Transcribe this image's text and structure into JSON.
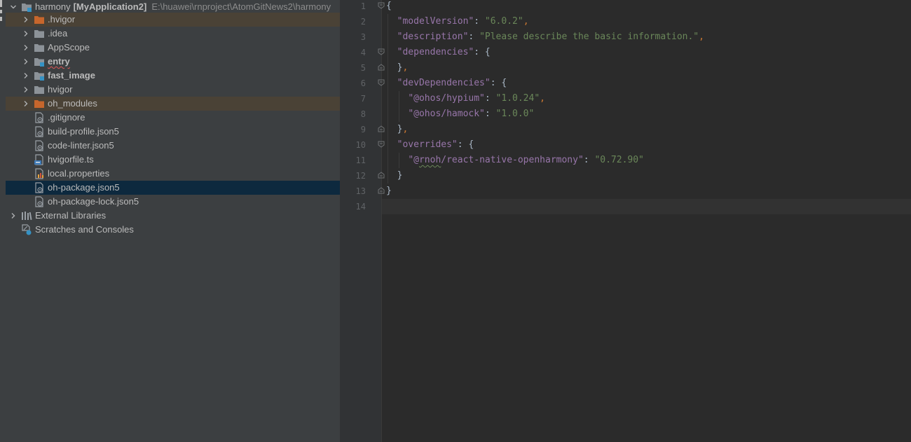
{
  "colors": {
    "panel_bg": "#3c3f41",
    "editor_bg": "#2b2b2b",
    "selection": "#0d293e",
    "excluded_row": "#4a4236",
    "key": "#9876aa",
    "string": "#6a8759",
    "punct_comma": "#cc7832",
    "folder_orange": "#c7662c",
    "folder_gray": "#8c9298"
  },
  "project": {
    "root_name": "harmony",
    "root_module": "[MyApplication2]",
    "root_path": "E:\\huawei\\rnproject\\AtomGitNews2\\harmony",
    "items": [
      {
        "label": ".hvigor",
        "icon": "folder-orange-icon",
        "expandable": true,
        "bold": false,
        "excluded": true
      },
      {
        "label": ".idea",
        "icon": "folder-icon",
        "expandable": true,
        "bold": false
      },
      {
        "label": "AppScope",
        "icon": "folder-icon",
        "expandable": true,
        "bold": false
      },
      {
        "label": "entry",
        "icon": "module-folder-icon",
        "expandable": true,
        "bold": true
      },
      {
        "label": "fast_image",
        "icon": "module-folder-icon",
        "expandable": true,
        "bold": true
      },
      {
        "label": "hvigor",
        "icon": "folder-icon",
        "expandable": true,
        "bold": false
      },
      {
        "label": "oh_modules",
        "icon": "folder-orange-icon",
        "expandable": true,
        "bold": false,
        "excluded": true
      },
      {
        "label": ".gitignore",
        "icon": "file-config-icon",
        "expandable": false,
        "bold": false
      },
      {
        "label": "build-profile.json5",
        "icon": "file-config-icon",
        "expandable": false,
        "bold": false
      },
      {
        "label": "code-linter.json5",
        "icon": "file-config-icon",
        "expandable": false,
        "bold": false
      },
      {
        "label": "hvigorfile.ts",
        "icon": "file-ts-icon",
        "expandable": false,
        "bold": false
      },
      {
        "label": "local.properties",
        "icon": "file-properties-icon",
        "expandable": false,
        "bold": false
      },
      {
        "label": "oh-package.json5",
        "icon": "file-config-icon",
        "expandable": false,
        "bold": false,
        "selected": true
      },
      {
        "label": "oh-package-lock.json5",
        "icon": "file-config-icon",
        "expandable": false,
        "bold": false
      }
    ],
    "external_libraries": "External Libraries",
    "scratches": "Scratches and Consoles"
  },
  "editor": {
    "line_numbers": [
      "1",
      "2",
      "3",
      "4",
      "5",
      "6",
      "7",
      "8",
      "9",
      "10",
      "11",
      "12",
      "13",
      "14"
    ],
    "lines": {
      "l1": {
        "brace": "{"
      },
      "l2": {
        "key": "\"modelVersion\"",
        "sep": ": ",
        "value": "\"6.0.2\"",
        "comma": ","
      },
      "l3": {
        "key": "\"description\"",
        "sep": ": ",
        "value": "\"Please describe the basic information.\"",
        "comma": ","
      },
      "l4": {
        "key": "\"dependencies\"",
        "sep": ": ",
        "brace": "{"
      },
      "l5": {
        "brace": "}",
        "comma": ","
      },
      "l6": {
        "key": "\"devDependencies\"",
        "sep": ": ",
        "brace": "{"
      },
      "l7": {
        "key": "\"@ohos/hypium\"",
        "sep": ": ",
        "value": "\"1.0.24\"",
        "comma": ","
      },
      "l8": {
        "key": "\"@ohos/hamock\"",
        "sep": ": ",
        "value": "\"1.0.0\""
      },
      "l9": {
        "brace": "}",
        "comma": ","
      },
      "l10": {
        "key": "\"overrides\"",
        "sep": ": ",
        "brace": "{"
      },
      "l11": {
        "key_q": "\"@",
        "key_w": "rnoh",
        "key_rest": "/react-native-openharmony\"",
        "sep": ": ",
        "value": "\"0.72.90\""
      },
      "l12": {
        "brace": "}"
      },
      "l13": {
        "brace": "}"
      }
    }
  }
}
